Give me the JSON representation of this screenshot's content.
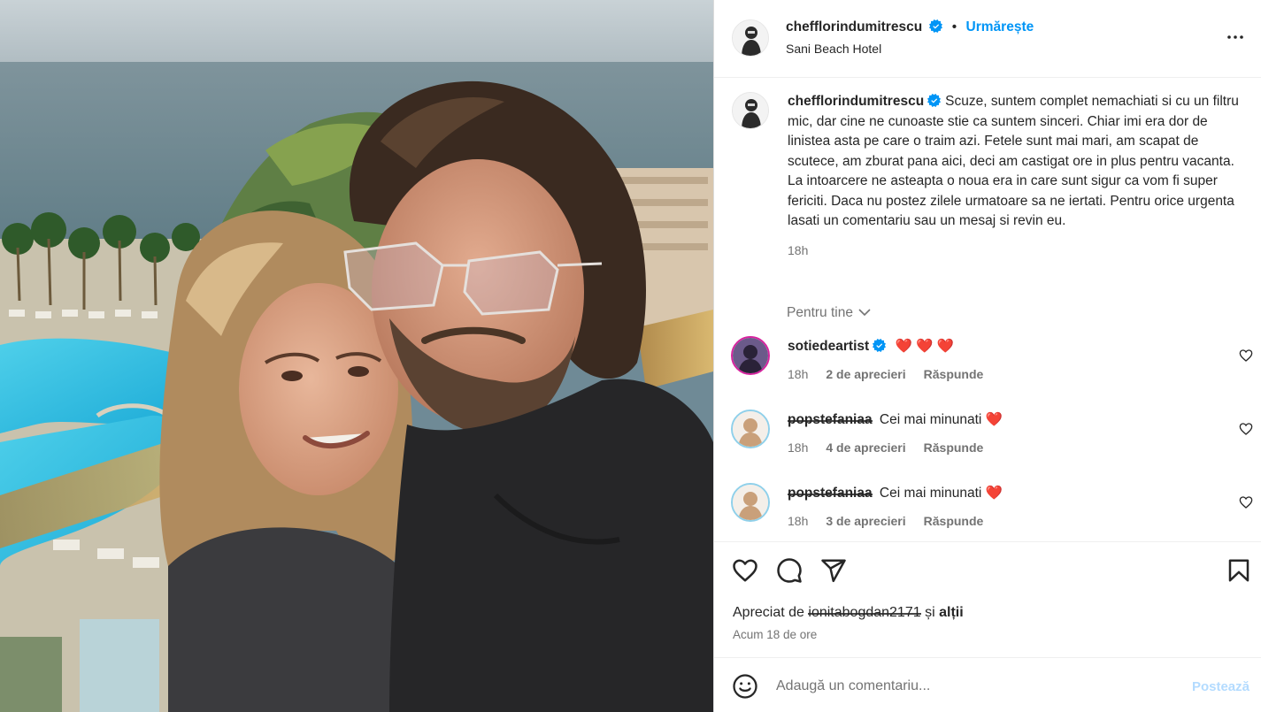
{
  "post": {
    "username": "chefflorindumitrescu",
    "dot": "•",
    "follow_label": "Urmărește",
    "location": "Sani Beach Hotel",
    "caption": "Scuze, suntem complet nemachiati si cu un filtru mic, dar cine ne cunoaste stie ca suntem sinceri. Chiar imi era dor de linistea asta pe care o traim azi. Fetele sunt mai mari, am scapat de scutece, am zburat pana aici, deci am castigat ore in plus pentru vacanta. La intoarcere ne asteapta o noua era in care sunt sigur ca vom fi super fericiti. Daca nu postez zilele urmatoare sa ne iertati. Pentru orice urgenta lasati un comentariu sau un mesaj si revin eu.",
    "caption_time": "18h"
  },
  "filter_label": "Pentru tine",
  "comments": [
    {
      "username": "sotiedeartist",
      "text": "",
      "hearts": "❤️ ❤️ ❤️",
      "time": "18h",
      "likes": "2 de aprecieri",
      "reply": "Răspunde"
    },
    {
      "username": "popstefaniaa",
      "text": "Cei mai minunati",
      "hearts": "❤️",
      "time": "18h",
      "likes": "4 de aprecieri",
      "reply": "Răspunde"
    },
    {
      "username": "popstefaniaa",
      "text": "Cei mai minunati",
      "hearts": "❤️",
      "time": "18h",
      "likes": "3 de aprecieri",
      "reply": "Răspunde"
    }
  ],
  "likes_summary": {
    "prefix": "Apreciat de",
    "user": "ionitabogdan2171",
    "connector": "și",
    "suffix": "alții"
  },
  "posted_ago": "Acum 18 de ore",
  "add_comment": {
    "placeholder": "Adaugă un comentariu...",
    "post_label": "Postează"
  },
  "colors": {
    "accent": "#0095f6",
    "verified": "#0095f6",
    "heart": "#ed4956",
    "muted": "#737373",
    "post_disabled": "#b3dbff"
  }
}
